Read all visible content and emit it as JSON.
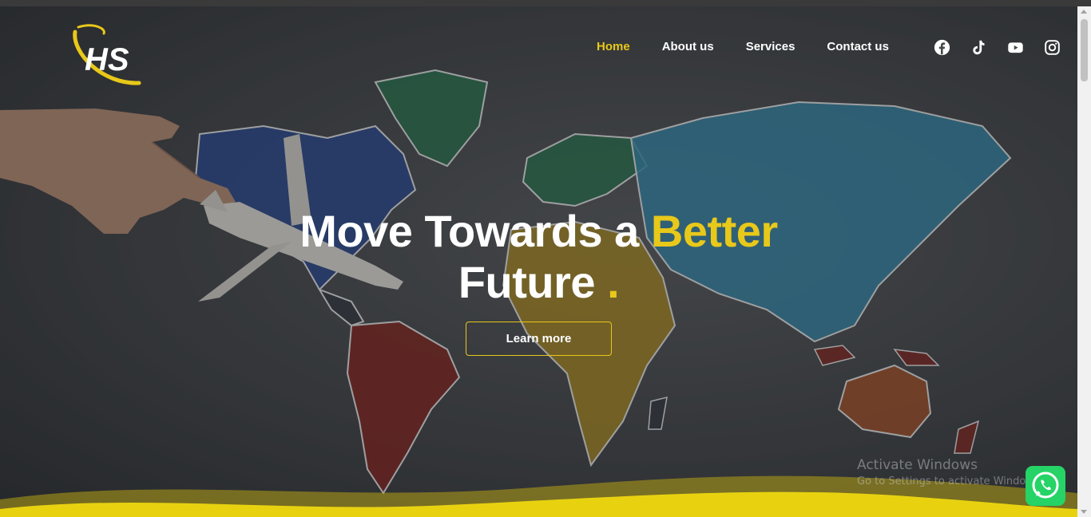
{
  "brand": {
    "logo_text": "HS",
    "accent": "#e8c81a"
  },
  "nav": {
    "items": [
      {
        "label": "Home",
        "active": true
      },
      {
        "label": "About us",
        "active": false
      },
      {
        "label": "Services",
        "active": false
      },
      {
        "label": "Contact us",
        "active": false
      }
    ]
  },
  "social": [
    "facebook-icon",
    "tiktok-icon",
    "youtube-icon",
    "instagram-icon"
  ],
  "hero": {
    "line1_prefix": "Move Towards a ",
    "line1_accent": "Better",
    "line2": "Future ",
    "line2_dot": ".",
    "cta_label": "Learn more"
  },
  "watermark": {
    "line1": "Activate Windows",
    "line2": "Go to Settings to activate Windows."
  },
  "colors": {
    "accent": "#e8c81a",
    "whatsapp": "#25d366",
    "text": "#ffffff"
  }
}
